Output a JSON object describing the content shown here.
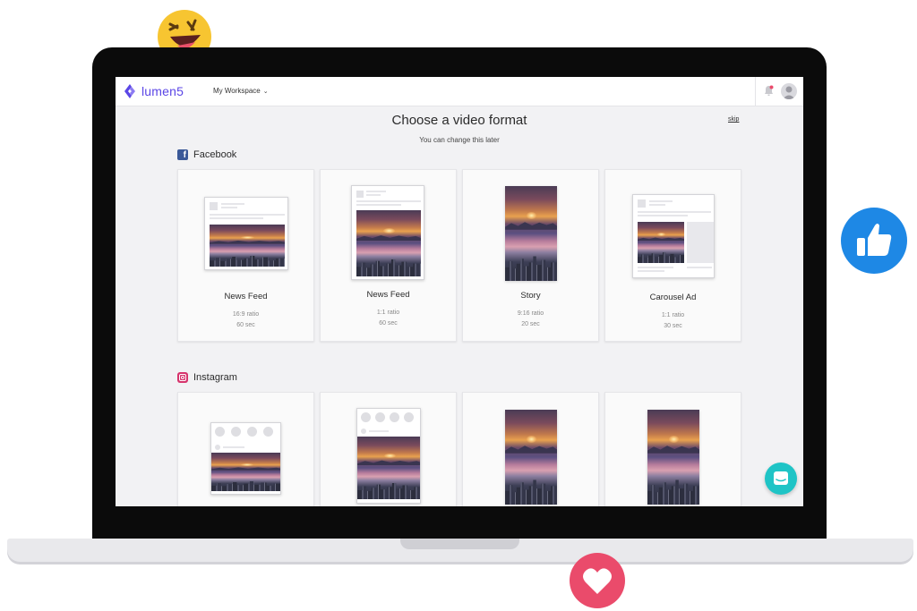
{
  "app": {
    "brand": "lumen5",
    "workspace_label": "My Workspace",
    "brand_color": "#5b46e6"
  },
  "page": {
    "title": "Choose a video format",
    "subtitle": "You can change this later",
    "skip_label": "skip"
  },
  "sections": [
    {
      "name": "Facebook",
      "icon": "facebook-icon",
      "color": "#3b5998",
      "cards": [
        {
          "label": "News Feed",
          "ratio": "16:9 ratio",
          "duration": "60 sec"
        },
        {
          "label": "News Feed",
          "ratio": "1:1 ratio",
          "duration": "60 sec"
        },
        {
          "label": "Story",
          "ratio": "9:16 ratio",
          "duration": "20 sec"
        },
        {
          "label": "Carousel Ad",
          "ratio": "1:1 ratio",
          "duration": "30 sec"
        }
      ]
    },
    {
      "name": "Instagram",
      "icon": "instagram-icon",
      "color": "#d6336c",
      "cards": [
        {
          "label": "",
          "ratio": "",
          "duration": ""
        },
        {
          "label": "",
          "ratio": "",
          "duration": ""
        },
        {
          "label": "",
          "ratio": "",
          "duration": ""
        },
        {
          "label": "",
          "ratio": "",
          "duration": ""
        }
      ]
    }
  ],
  "decorations": {
    "reactions": [
      "laughing-emoji-icon",
      "thumbs-up-icon",
      "heart-icon"
    ],
    "chat_button_color": "#1fc4c6"
  }
}
